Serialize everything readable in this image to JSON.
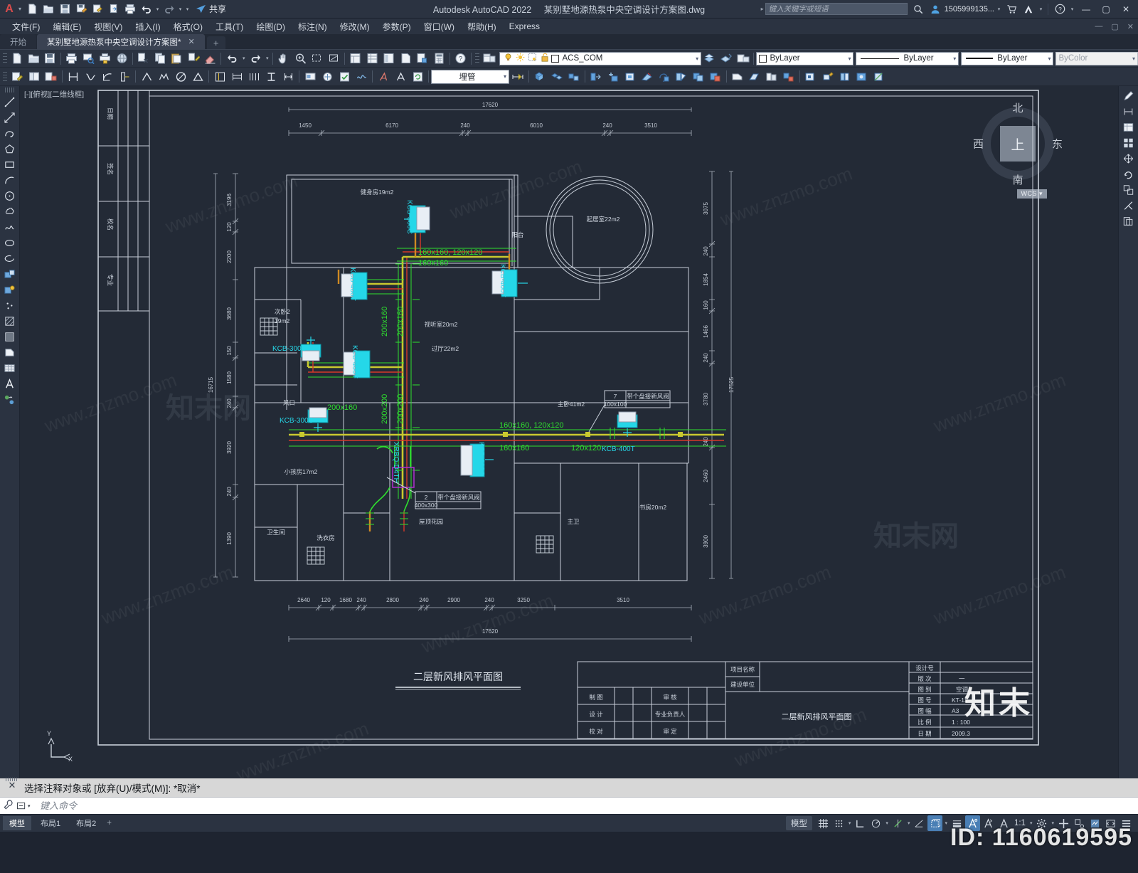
{
  "titlebar": {
    "app_name": "Autodesk AutoCAD 2022",
    "document_name": "某别墅地源热泵中央空调设计方案图.dwg",
    "share_label": "共享",
    "search_placeholder": "键入关键字或短语",
    "user_account": "1505999135...",
    "icons": [
      "new-file-icon",
      "open-folder-icon",
      "save-icon",
      "save-as-icon",
      "print-preview-icon",
      "plot-icon",
      "print-icon",
      "undo-icon",
      "redo-icon",
      "share-icon"
    ],
    "window_buttons": [
      "minimize",
      "maximize",
      "close"
    ]
  },
  "menubar": {
    "items": [
      {
        "label": "文件(F)"
      },
      {
        "label": "编辑(E)"
      },
      {
        "label": "视图(V)"
      },
      {
        "label": "插入(I)"
      },
      {
        "label": "格式(O)"
      },
      {
        "label": "工具(T)"
      },
      {
        "label": "绘图(D)"
      },
      {
        "label": "标注(N)"
      },
      {
        "label": "修改(M)"
      },
      {
        "label": "参数(P)"
      },
      {
        "label": "窗口(W)"
      },
      {
        "label": "帮助(H)"
      },
      {
        "label": "Express"
      }
    ]
  },
  "file_tabs": {
    "start_tab": "开始",
    "active_tab": "某别墅地源热泵中央空调设计方案图*",
    "close_glyph": "✕",
    "add_glyph": "+"
  },
  "layer_toolbar": {
    "layer_name": "ACS_COM",
    "color_value": "ByLayer",
    "linetype_value": "ByLayer",
    "lineweight_value": "ByLayer",
    "plotstyle_value": "ByColor",
    "object_group": "埋管"
  },
  "viewport": {
    "label": "[-][俯视][二维线框]",
    "viewcube": {
      "north": "北",
      "south": "南",
      "west": "西",
      "east": "东",
      "top": "上"
    },
    "ucs_badge": "WCS",
    "ucs_axes": {
      "x": "X",
      "y": "Y"
    }
  },
  "drawing": {
    "plan_title": "二层新风排风平面图",
    "top_dim_total": "17620",
    "top_dims": [
      "1450",
      "6170",
      "240",
      "6010",
      "240",
      "3510"
    ],
    "bottom_dim_total": "17620",
    "bottom_dims": [
      "2640",
      "120",
      "1680",
      "240",
      "2800",
      "240",
      "2900",
      "240",
      "3250",
      "3510"
    ],
    "left_dim_total": "16715",
    "left_dims": [
      "3196",
      "120",
      "2200",
      "3680",
      "150",
      "1580",
      "240",
      "3920",
      "240",
      "1390"
    ],
    "right_dim_total": "17525",
    "right_dims": [
      "3075",
      "240",
      "1854",
      "160",
      "1466",
      "240",
      "3780",
      "240",
      "2460",
      "3900"
    ],
    "rooms": [
      {
        "name": "健身房19m2"
      },
      {
        "name": "起居室22m2"
      },
      {
        "name": "阳台"
      },
      {
        "name": "次卧2"
      },
      {
        "name": "19m2"
      },
      {
        "name": "视听室20m2"
      },
      {
        "name": "过厅22m2"
      },
      {
        "name": "主卧41m2"
      },
      {
        "name": "小孩房17m2"
      },
      {
        "name": "卫生间"
      },
      {
        "name": "洗衣房"
      },
      {
        "name": "屋顶花园"
      },
      {
        "name": "主卫"
      },
      {
        "name": "书房20m2"
      },
      {
        "name": "风口"
      }
    ],
    "duct_labels": [
      "160x160, 120x120",
      "160x160",
      "200x160",
      "200x160",
      "200x200",
      "200x200",
      "200x160",
      "160x160, 120x120",
      "160x160",
      "120x120"
    ],
    "equipment_labels": [
      "KCB-300C",
      "KCB-300C",
      "KCB-300C",
      "KCB-400T",
      "KCB-400T",
      "KCB-400T",
      "KCB-400T",
      "KCB-400T",
      "XRBQ-D4TH"
    ],
    "callouts": [
      {
        "num": "7",
        "size": "100x100",
        "text": "带个盘接新风阀"
      },
      {
        "num": "2",
        "size": "400x300",
        "text": "带个盘接新风阀"
      }
    ],
    "title_block_left_rows": [
      "日期",
      "签名",
      "校名",
      "专业"
    ],
    "title_block": {
      "project_name_label": "项目名称",
      "project_name_value": "",
      "client_label": "建设单位",
      "client_value": "",
      "drawn_label": "制  图",
      "design_label": "设  计",
      "check_label": "校  对",
      "review_label": "审  核",
      "responsible_label": "专业负责人",
      "approve_label": "审  定",
      "sheet_title": "二层新风排风平面图",
      "meta": [
        {
          "label": "设计号",
          "value": ""
        },
        {
          "label": "版  次",
          "value": "一"
        },
        {
          "label": "图  别",
          "value": "空调"
        },
        {
          "label": "图  号",
          "value": "KT-11"
        },
        {
          "label": "图  幅",
          "value": "A3"
        },
        {
          "label": "比  例",
          "value": "1 : 100"
        },
        {
          "label": "日  期",
          "value": "2009.3"
        }
      ]
    }
  },
  "command_line": {
    "history": "选择注释对象或 [放弃(U)/模式(M)]: *取消*",
    "input_placeholder": "键入命令"
  },
  "statusbar": {
    "layout_tabs": [
      "模型",
      "布局1",
      "布局2"
    ],
    "add_layout": "+",
    "model_label": "模型",
    "scale": "1:1",
    "icons": [
      "grid-icon",
      "snap-icon",
      "ortho-icon",
      "polar-icon",
      "osnap-icon",
      "otrack-icon",
      "lineweight-icon",
      "transparency-icon",
      "selection-cycling-icon",
      "annotation-visibility-icon",
      "annotation-scale-icon",
      "workspace-gear-icon",
      "hardware-accel-icon",
      "isolate-objects-icon",
      "clean-screen-icon",
      "customization-icon"
    ]
  },
  "watermarks": {
    "site": "www.znzmo.com",
    "brand": "知末",
    "id": "ID: 1160619595"
  },
  "colors": {
    "chrome": "#2b3341",
    "canvas": "#232a36",
    "accent": "#4a7fb5",
    "duct_green": "#3cf03c",
    "duct_cyan": "#2ee0f0",
    "duct_red": "#e03a2a",
    "duct_yellow": "#d8d83a",
    "wall_white": "#cfd5de"
  }
}
